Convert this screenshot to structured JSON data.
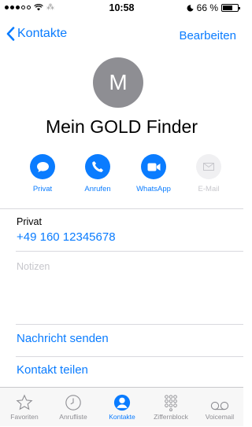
{
  "status_bar": {
    "time": "10:58",
    "battery": "66 %",
    "battery_level": 0.66
  },
  "nav": {
    "back_label": "Kontakte",
    "edit_label": "Bearbeiten"
  },
  "contact": {
    "initial": "M",
    "name": "Mein GOLD Finder"
  },
  "actions": [
    {
      "label": "Privat",
      "icon": "message-icon",
      "enabled": true
    },
    {
      "label": "Anrufen",
      "icon": "phone-icon",
      "enabled": true
    },
    {
      "label": "WhatsApp",
      "icon": "video-icon",
      "enabled": true
    },
    {
      "label": "E-Mail",
      "icon": "mail-icon",
      "enabled": false
    }
  ],
  "phone_field": {
    "label": "Privat",
    "value": "+49 160 12345678"
  },
  "notes": {
    "placeholder": "Notizen"
  },
  "links": {
    "send_message": "Nachricht senden",
    "share_contact": "Kontakt teilen"
  },
  "tabs": [
    {
      "label": "Favoriten",
      "icon": "star-icon",
      "active": false
    },
    {
      "label": "Anrufliste",
      "icon": "clock-icon",
      "active": false
    },
    {
      "label": "Kontakte",
      "icon": "person-icon",
      "active": true
    },
    {
      "label": "Ziffernblock",
      "icon": "keypad-icon",
      "active": false
    },
    {
      "label": "Voicemail",
      "icon": "voicemail-icon",
      "active": false
    }
  ],
  "colors": {
    "accent": "#0a7cff",
    "avatar": "#8e8e93",
    "inactive": "#8e8e93",
    "disabled": "#c7c7cc"
  }
}
